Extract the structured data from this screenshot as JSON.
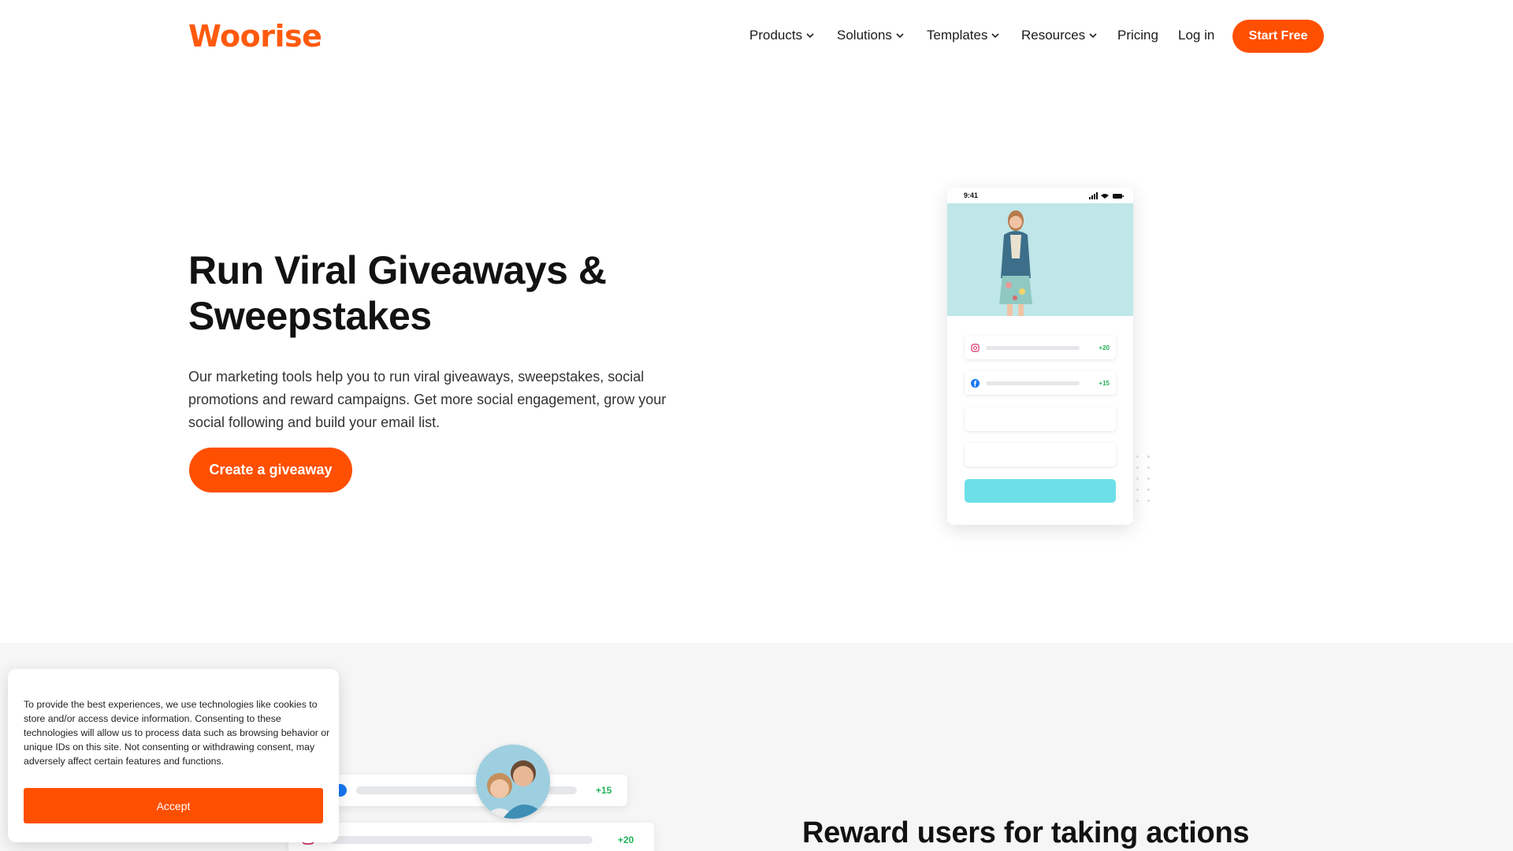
{
  "brand": {
    "logo": "Woorise",
    "accent": "#ff4f00"
  },
  "nav": {
    "items": [
      {
        "label": "Products",
        "dropdown": true
      },
      {
        "label": "Solutions",
        "dropdown": true
      },
      {
        "label": "Templates",
        "dropdown": true
      },
      {
        "label": "Resources",
        "dropdown": true
      },
      {
        "label": "Pricing",
        "dropdown": false
      },
      {
        "label": "Log in",
        "dropdown": false
      }
    ],
    "cta": "Start Free"
  },
  "hero": {
    "title_line1": "Run Viral Giveaways &",
    "title_line2": "Sweepstakes",
    "description": "Our marketing tools help you to run viral giveaways, sweepstakes, social promotions and reward campaigns. Get more social engagement, grow your social following and build your email list.",
    "cta": "Create a giveaway"
  },
  "phone": {
    "time": "9:41",
    "rows": [
      {
        "icon": "instagram-icon",
        "points": "+20"
      },
      {
        "icon": "facebook-icon",
        "points": "+15"
      }
    ]
  },
  "section2": {
    "title": "Reward users for taking actions",
    "cards": [
      {
        "icon": "facebook-icon",
        "points": "+15"
      },
      {
        "icon": "instagram-icon",
        "points": "+20"
      }
    ]
  },
  "cookie": {
    "text": "To provide the best experiences, we use technologies like cookies to store and/or access device information. Consenting to these technologies will allow us to process data such as browsing behavior or unique IDs on this site. Not consenting or withdrawing consent, may adversely affect certain features and functions.",
    "accept": "Accept"
  }
}
